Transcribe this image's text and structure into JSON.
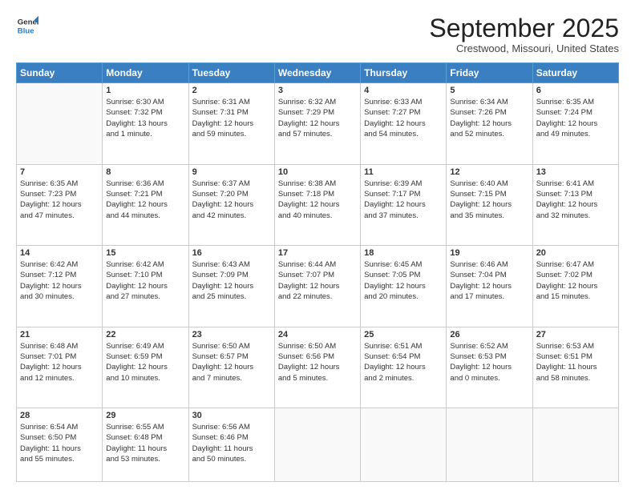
{
  "logo": {
    "general": "General",
    "blue": "Blue"
  },
  "header": {
    "month": "September 2025",
    "location": "Crestwood, Missouri, United States"
  },
  "weekdays": [
    "Sunday",
    "Monday",
    "Tuesday",
    "Wednesday",
    "Thursday",
    "Friday",
    "Saturday"
  ],
  "weeks": [
    [
      {
        "day": "",
        "info": ""
      },
      {
        "day": "1",
        "info": "Sunrise: 6:30 AM\nSunset: 7:32 PM\nDaylight: 13 hours\nand 1 minute."
      },
      {
        "day": "2",
        "info": "Sunrise: 6:31 AM\nSunset: 7:31 PM\nDaylight: 12 hours\nand 59 minutes."
      },
      {
        "day": "3",
        "info": "Sunrise: 6:32 AM\nSunset: 7:29 PM\nDaylight: 12 hours\nand 57 minutes."
      },
      {
        "day": "4",
        "info": "Sunrise: 6:33 AM\nSunset: 7:27 PM\nDaylight: 12 hours\nand 54 minutes."
      },
      {
        "day": "5",
        "info": "Sunrise: 6:34 AM\nSunset: 7:26 PM\nDaylight: 12 hours\nand 52 minutes."
      },
      {
        "day": "6",
        "info": "Sunrise: 6:35 AM\nSunset: 7:24 PM\nDaylight: 12 hours\nand 49 minutes."
      }
    ],
    [
      {
        "day": "7",
        "info": "Sunrise: 6:35 AM\nSunset: 7:23 PM\nDaylight: 12 hours\nand 47 minutes."
      },
      {
        "day": "8",
        "info": "Sunrise: 6:36 AM\nSunset: 7:21 PM\nDaylight: 12 hours\nand 44 minutes."
      },
      {
        "day": "9",
        "info": "Sunrise: 6:37 AM\nSunset: 7:20 PM\nDaylight: 12 hours\nand 42 minutes."
      },
      {
        "day": "10",
        "info": "Sunrise: 6:38 AM\nSunset: 7:18 PM\nDaylight: 12 hours\nand 40 minutes."
      },
      {
        "day": "11",
        "info": "Sunrise: 6:39 AM\nSunset: 7:17 PM\nDaylight: 12 hours\nand 37 minutes."
      },
      {
        "day": "12",
        "info": "Sunrise: 6:40 AM\nSunset: 7:15 PM\nDaylight: 12 hours\nand 35 minutes."
      },
      {
        "day": "13",
        "info": "Sunrise: 6:41 AM\nSunset: 7:13 PM\nDaylight: 12 hours\nand 32 minutes."
      }
    ],
    [
      {
        "day": "14",
        "info": "Sunrise: 6:42 AM\nSunset: 7:12 PM\nDaylight: 12 hours\nand 30 minutes."
      },
      {
        "day": "15",
        "info": "Sunrise: 6:42 AM\nSunset: 7:10 PM\nDaylight: 12 hours\nand 27 minutes."
      },
      {
        "day": "16",
        "info": "Sunrise: 6:43 AM\nSunset: 7:09 PM\nDaylight: 12 hours\nand 25 minutes."
      },
      {
        "day": "17",
        "info": "Sunrise: 6:44 AM\nSunset: 7:07 PM\nDaylight: 12 hours\nand 22 minutes."
      },
      {
        "day": "18",
        "info": "Sunrise: 6:45 AM\nSunset: 7:05 PM\nDaylight: 12 hours\nand 20 minutes."
      },
      {
        "day": "19",
        "info": "Sunrise: 6:46 AM\nSunset: 7:04 PM\nDaylight: 12 hours\nand 17 minutes."
      },
      {
        "day": "20",
        "info": "Sunrise: 6:47 AM\nSunset: 7:02 PM\nDaylight: 12 hours\nand 15 minutes."
      }
    ],
    [
      {
        "day": "21",
        "info": "Sunrise: 6:48 AM\nSunset: 7:01 PM\nDaylight: 12 hours\nand 12 minutes."
      },
      {
        "day": "22",
        "info": "Sunrise: 6:49 AM\nSunset: 6:59 PM\nDaylight: 12 hours\nand 10 minutes."
      },
      {
        "day": "23",
        "info": "Sunrise: 6:50 AM\nSunset: 6:57 PM\nDaylight: 12 hours\nand 7 minutes."
      },
      {
        "day": "24",
        "info": "Sunrise: 6:50 AM\nSunset: 6:56 PM\nDaylight: 12 hours\nand 5 minutes."
      },
      {
        "day": "25",
        "info": "Sunrise: 6:51 AM\nSunset: 6:54 PM\nDaylight: 12 hours\nand 2 minutes."
      },
      {
        "day": "26",
        "info": "Sunrise: 6:52 AM\nSunset: 6:53 PM\nDaylight: 12 hours\nand 0 minutes."
      },
      {
        "day": "27",
        "info": "Sunrise: 6:53 AM\nSunset: 6:51 PM\nDaylight: 11 hours\nand 58 minutes."
      }
    ],
    [
      {
        "day": "28",
        "info": "Sunrise: 6:54 AM\nSunset: 6:50 PM\nDaylight: 11 hours\nand 55 minutes."
      },
      {
        "day": "29",
        "info": "Sunrise: 6:55 AM\nSunset: 6:48 PM\nDaylight: 11 hours\nand 53 minutes."
      },
      {
        "day": "30",
        "info": "Sunrise: 6:56 AM\nSunset: 6:46 PM\nDaylight: 11 hours\nand 50 minutes."
      },
      {
        "day": "",
        "info": ""
      },
      {
        "day": "",
        "info": ""
      },
      {
        "day": "",
        "info": ""
      },
      {
        "day": "",
        "info": ""
      }
    ]
  ]
}
